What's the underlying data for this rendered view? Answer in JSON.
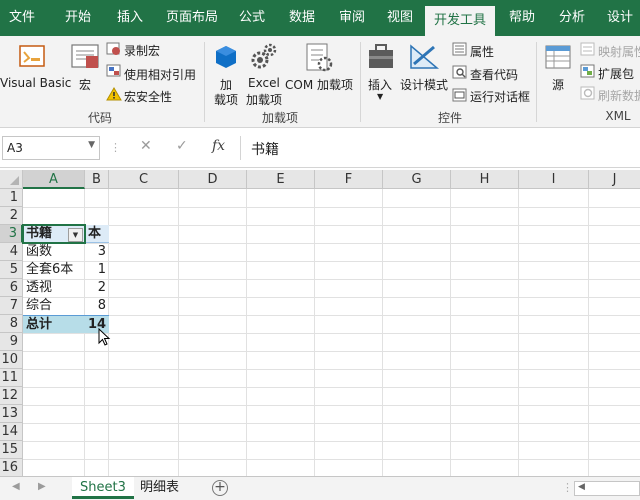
{
  "tabs": [
    "文件",
    "开始",
    "插入",
    "页面布局",
    "公式",
    "数据",
    "审阅",
    "视图",
    "开发工具",
    "帮助",
    "分析",
    "设计"
  ],
  "active_tab": "开发工具",
  "ribbon": {
    "code": {
      "visual_basic": "Visual Basic",
      "macros": "宏",
      "record_macro": "录制宏",
      "relative_ref": "使用相对引用",
      "macro_security": "宏安全性",
      "label": "代码"
    },
    "addins": {
      "addins_line1": "加",
      "addins_line2": "载项",
      "excel_line1": "Excel",
      "excel_line2": "加载项",
      "com": "COM 加载项",
      "label": "加载项"
    },
    "controls": {
      "insert": "插入",
      "design_mode": "设计模式",
      "properties": "属性",
      "view_code": "查看代码",
      "run_dialog": "运行对话框",
      "label": "控件"
    },
    "xml": {
      "source": "源",
      "map_properties": "映射属性",
      "expansion_packs": "扩展包",
      "refresh_data": "刷新数据",
      "label": "XML"
    }
  },
  "formula_bar": {
    "name_box": "A3",
    "cancel": "✕",
    "enter": "✓",
    "fx": "fx",
    "value": "书籍"
  },
  "columns": [
    "A",
    "B",
    "C",
    "D",
    "E",
    "F",
    "G",
    "H",
    "I",
    "J"
  ],
  "rows": [
    "1",
    "2",
    "3",
    "4",
    "5",
    "6",
    "7",
    "8",
    "9",
    "10",
    "11",
    "12",
    "13",
    "14",
    "15",
    "16"
  ],
  "pivot": {
    "header_a": "书籍",
    "header_b": "本",
    "items": [
      {
        "name": "函数",
        "count": "3"
      },
      {
        "name": "全套6本",
        "count": "1"
      },
      {
        "name": "透视",
        "count": "2"
      },
      {
        "name": "综合",
        "count": "8"
      }
    ],
    "total_label": "总计",
    "total_value": "14"
  },
  "sheets": [
    "Sheet3",
    "明细表"
  ],
  "active_sheet": "Sheet3",
  "add_sheet": "+",
  "colors": {
    "accent": "#217346",
    "pivot_header": "#ddebf7",
    "pivot_total": "#b7dde8"
  }
}
